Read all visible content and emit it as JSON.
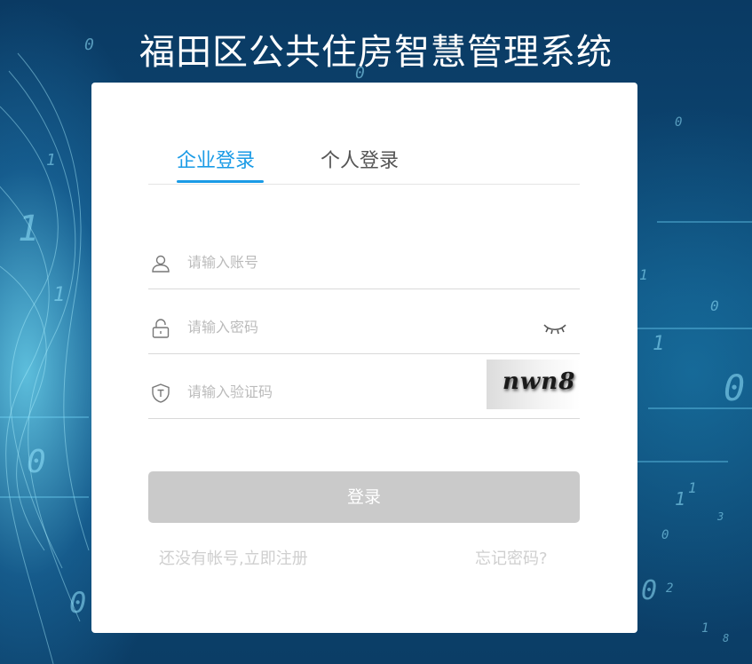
{
  "app": {
    "title": "福田区公共住房智慧管理系统"
  },
  "login": {
    "tabs": [
      {
        "label": "企业登录",
        "active": true
      },
      {
        "label": "个人登录",
        "active": false
      }
    ],
    "fields": {
      "account_placeholder": "请输入账号",
      "password_placeholder": "请输入密码",
      "captcha_placeholder": "请输入验证码"
    },
    "captcha_text": "nwn8",
    "submit_label": "登录",
    "register_link": "还没有帐号,立即注册",
    "forgot_link": "忘记密码?"
  },
  "icons": {
    "account": "user-icon",
    "password": "lock-icon",
    "captcha": "shield-icon",
    "toggle": "eye-closed-icon"
  },
  "colors": {
    "accent": "#1a9be6",
    "button_disabled": "#cacaca",
    "link": "#cfcfcf"
  },
  "background_digits": [
    "0",
    "1",
    "0",
    "1",
    "0",
    "1",
    "0",
    "1",
    "0",
    "0",
    "1",
    "0",
    "1",
    "0",
    "1",
    "2",
    "3",
    "8",
    "0",
    "1"
  ]
}
